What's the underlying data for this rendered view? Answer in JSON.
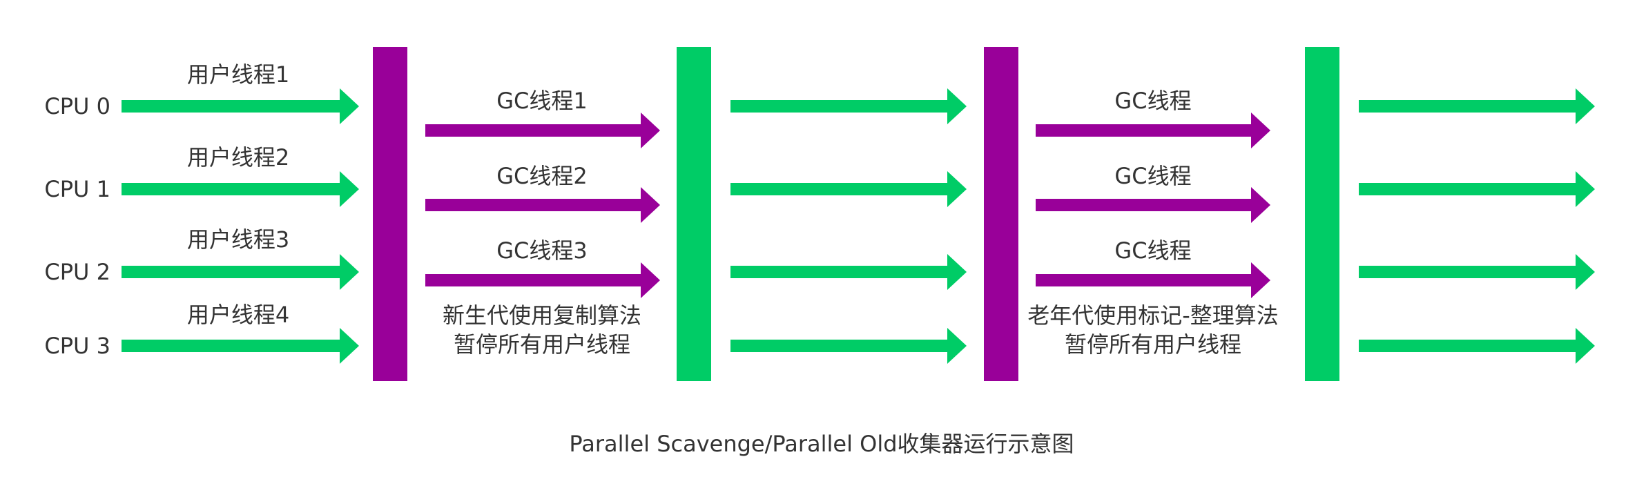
{
  "colors": {
    "user_thread": "#00CC66",
    "gc_thread": "#990099",
    "text": "#333333",
    "background": "#FFFFFF"
  },
  "cpus": [
    "CPU 0",
    "CPU 1",
    "CPU 2",
    "CPU 3"
  ],
  "user_threads": [
    "用户线程1",
    "用户线程2",
    "用户线程3",
    "用户线程4"
  ],
  "young_gc": {
    "threads": [
      "GC线程1",
      "GC线程2",
      "GC线程3"
    ],
    "note_line1": "新生代使用复制算法",
    "note_line2": "暂停所有用户线程"
  },
  "old_gc": {
    "threads": [
      "GC线程",
      "GC线程",
      "GC线程"
    ],
    "note_line1": "老年代使用标记-整理算法",
    "note_line2": "暂停所有用户线程"
  },
  "caption": "Parallel Scavenge/Parallel Old收集器运行示意图"
}
